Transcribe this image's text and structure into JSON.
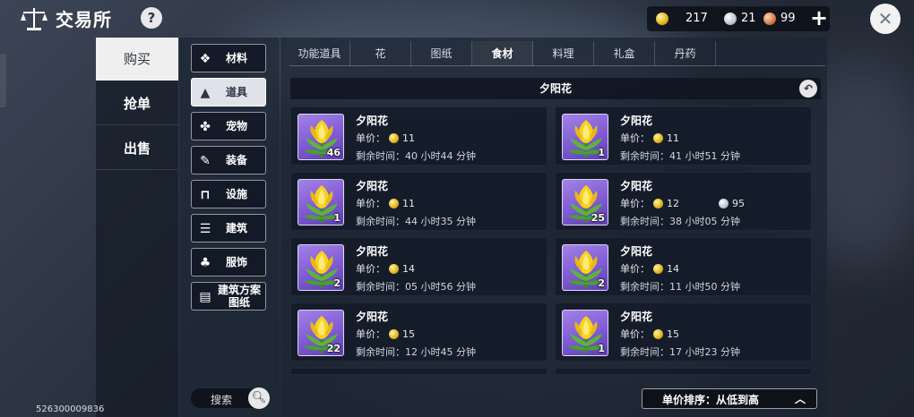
{
  "app": {
    "title": "交易所",
    "help": "?"
  },
  "currency": {
    "gold": "217",
    "silver": "21",
    "copper": "99",
    "add": "+"
  },
  "close_label": "✕",
  "left_tabs": [
    {
      "label": "购买",
      "active": true
    },
    {
      "label": "抢单",
      "active": false
    },
    {
      "label": "出售",
      "active": false
    }
  ],
  "categories": [
    {
      "label": "材料",
      "icon": "material-icon"
    },
    {
      "label": "道具",
      "icon": "flask-icon",
      "active": true
    },
    {
      "label": "宠物",
      "icon": "paw-icon"
    },
    {
      "label": "装备",
      "icon": "equipment-icon"
    },
    {
      "label": "设施",
      "icon": "facility-icon"
    },
    {
      "label": "建筑",
      "icon": "building-icon"
    },
    {
      "label": "服饰",
      "icon": "shirt-icon"
    },
    {
      "label_line1": "建筑方案",
      "label_line2": "图纸",
      "icon": "blueprint-icon"
    }
  ],
  "search": {
    "label": "搜索"
  },
  "uid": "526300009836",
  "subtabs": [
    "功能道具",
    "花",
    "图纸",
    "食材",
    "料理",
    "礼盒",
    "丹药"
  ],
  "active_subtab": "食材",
  "item_title": "夕阳花",
  "labels": {
    "price": "单价：",
    "time": "剩余时间："
  },
  "listings": [
    {
      "name": "夕阳花",
      "qty": "46",
      "price": "11",
      "time": "40 小时44 分钟"
    },
    {
      "name": "夕阳花",
      "qty": "1",
      "price": "11",
      "time": "41 小时51 分钟"
    },
    {
      "name": "夕阳花",
      "qty": "1",
      "price": "11",
      "time": "44 小时35 分钟"
    },
    {
      "name": "夕阳花",
      "qty": "25",
      "price": "12",
      "price2": "95",
      "time": "38 小时05 分钟"
    },
    {
      "name": "夕阳花",
      "qty": "2",
      "price": "14",
      "time": "05 小时56 分钟"
    },
    {
      "name": "夕阳花",
      "qty": "2",
      "price": "14",
      "time": "11 小时50 分钟"
    },
    {
      "name": "夕阳花",
      "qty": "22",
      "price": "15",
      "time": "12 小时45 分钟"
    },
    {
      "name": "夕阳花",
      "qty": "1",
      "price": "15",
      "time": "17 小时23 分钟"
    }
  ],
  "sort": {
    "label": "单价排序：从低到高"
  },
  "colors": {
    "gold": "#e3b21a",
    "silver": "#b9c6d2",
    "copper": "#d07a48",
    "item_bg": "#7f5ad4"
  }
}
